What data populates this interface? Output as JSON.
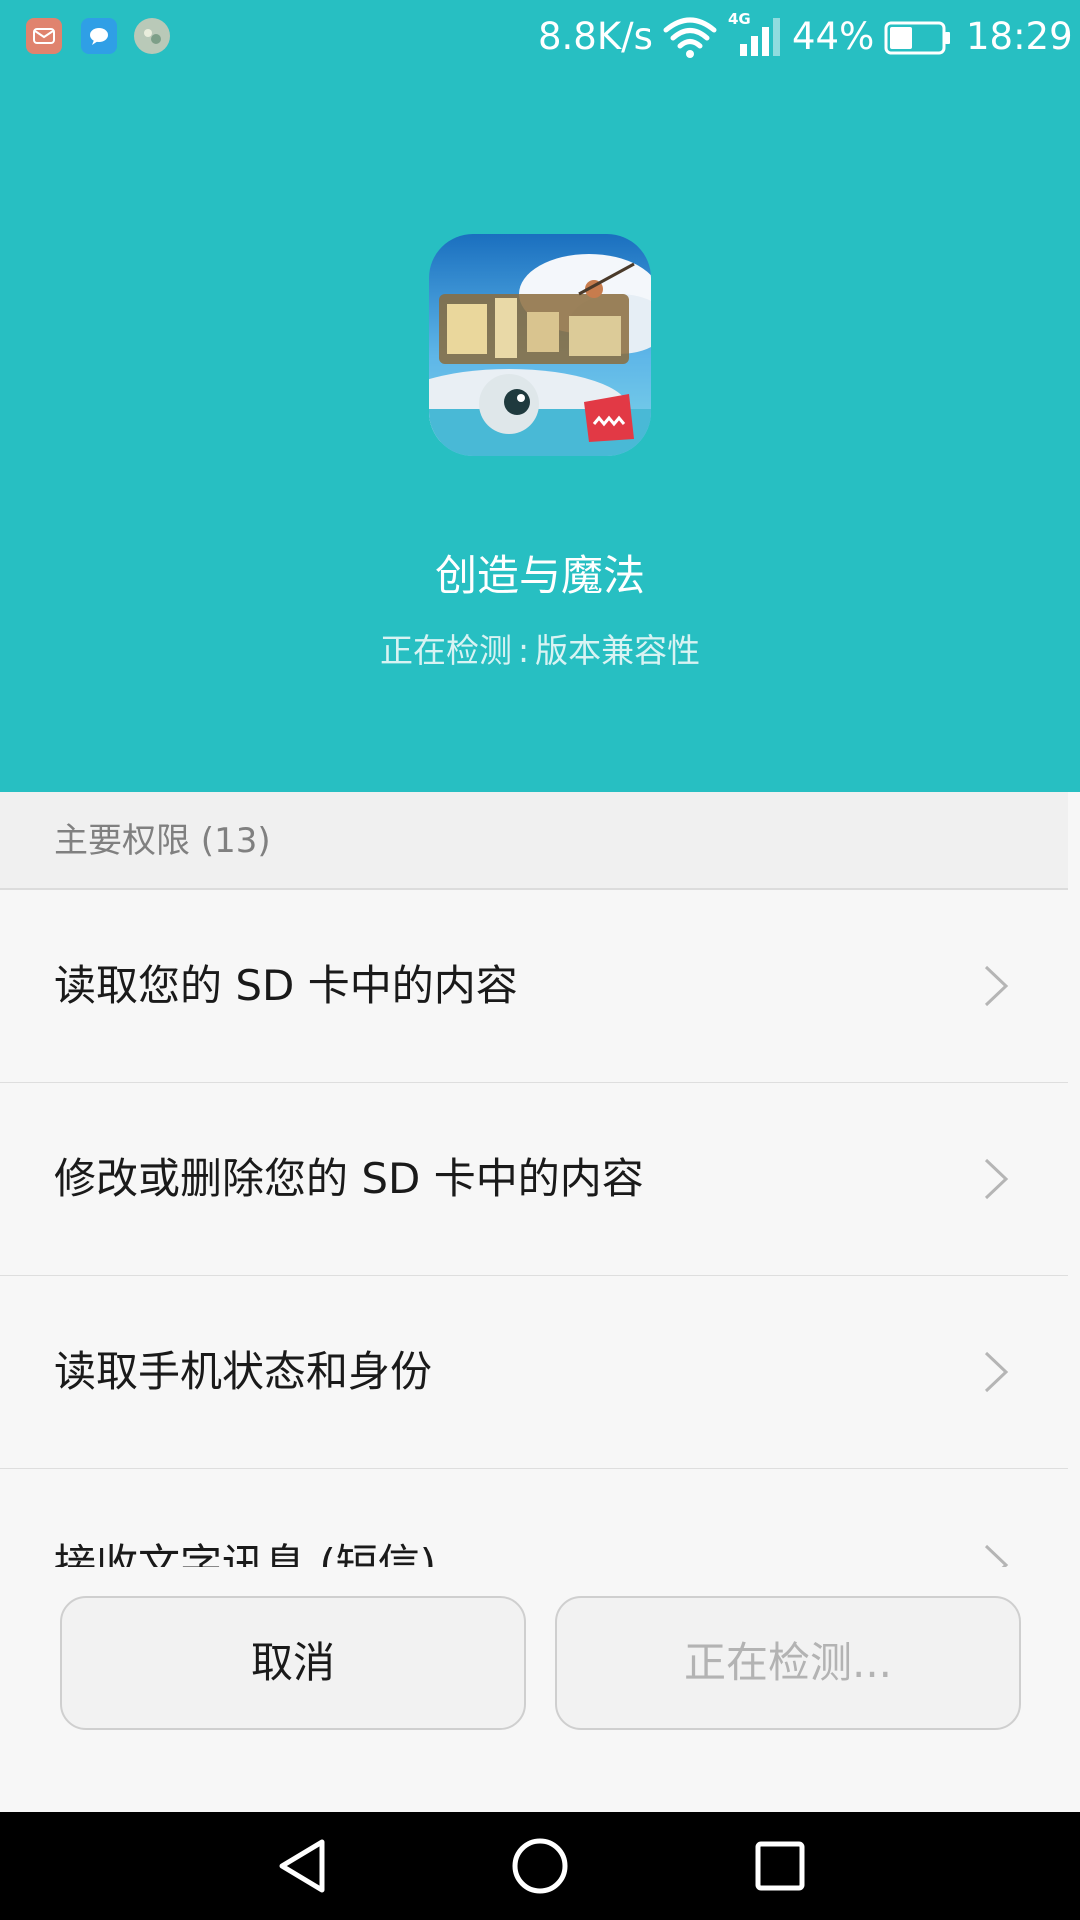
{
  "status_bar": {
    "net_speed": "8.8K/s",
    "network_type": "4G",
    "battery_percent": "44%",
    "battery_level": 0.44,
    "time": "18:29",
    "notification_icons": [
      "mail-icon",
      "message-icon",
      "photo-icon"
    ]
  },
  "app": {
    "name": "创造与魔法",
    "status_label": "正在检测",
    "status_separator": ":",
    "status_value": "版本兼容性"
  },
  "permissions": {
    "header": "主要权限 (13)",
    "items": [
      {
        "label": "读取您的 SD 卡中的内容"
      },
      {
        "label": "修改或删除您的 SD 卡中的内容"
      },
      {
        "label": "读取手机状态和身份"
      },
      {
        "label": "接收文字讯息 (短信)"
      }
    ]
  },
  "buttons": {
    "cancel": "取消",
    "detecting": "正在检测..."
  },
  "navigation": [
    "back-icon",
    "home-icon",
    "recent-apps-icon"
  ],
  "colors": {
    "header_bg": "#27bfc2",
    "page_bg": "#f7f7f7",
    "nav_bg": "#000000"
  }
}
